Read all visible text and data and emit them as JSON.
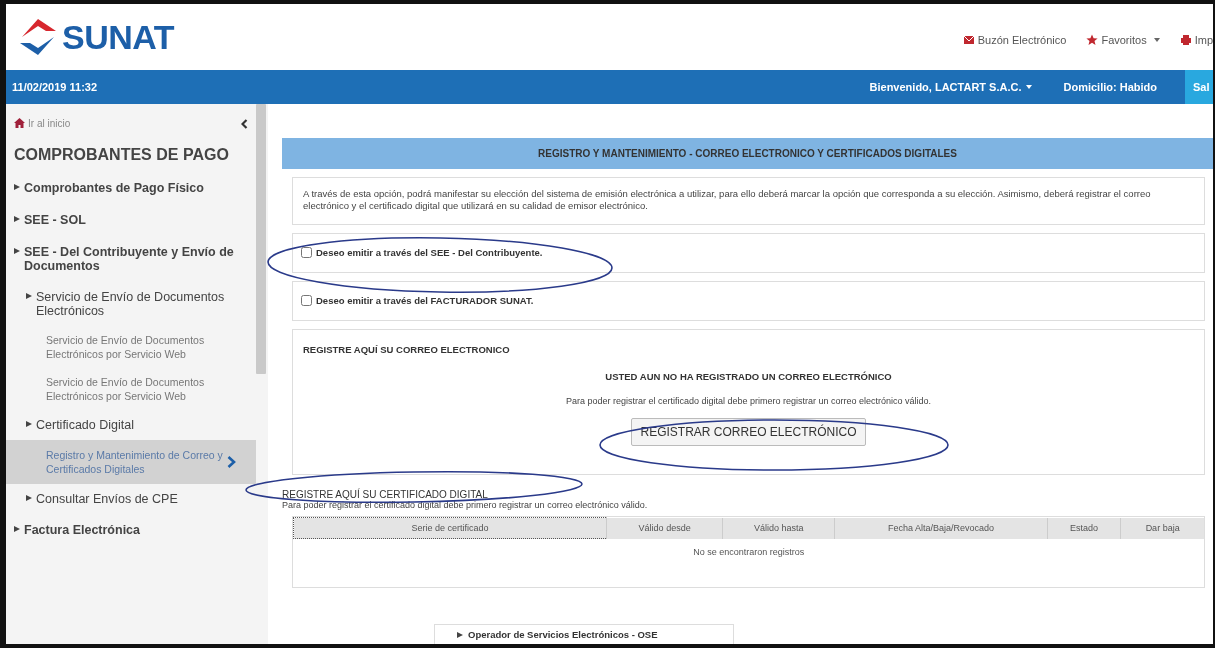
{
  "header": {
    "logo": "SUNAT",
    "links": [
      {
        "kind": "mail",
        "label": "Buzón Electrónico"
      },
      {
        "kind": "star",
        "label": "Favoritos",
        "dropdown": true
      },
      {
        "kind": "print",
        "label": "Imp"
      }
    ]
  },
  "top_bar": {
    "datetime": "11/02/2019 11:32",
    "welcome": "Bienvenido, LACTART S.A.C.",
    "domicile": "Domicilio: Habido",
    "button": "Sal"
  },
  "sidebar": {
    "home": "Ir al inicio",
    "heading": "COMPROBANTES DE PAGO",
    "items": [
      {
        "label": "Comprobantes de Pago Físico",
        "kind": "group",
        "selected": false
      },
      {
        "label": "SEE - SOL",
        "kind": "group",
        "selected": false
      },
      {
        "label": "SEE - Del Contribuyente y Envío de Documentos",
        "kind": "group",
        "selected": false,
        "children": [
          {
            "label": "Servicio de Envío de Documentos Electrónicos",
            "kind": "group",
            "selected": false,
            "children": [
              {
                "label": "Servicio de Envío de Documentos Electrónicos por Servicio Web",
                "kind": "link",
                "selected": false
              },
              {
                "label": "Servicio de Envío de Documentos Electrónicos por Servicio Web",
                "kind": "link",
                "selected": false
              }
            ]
          },
          {
            "label": "Certificado Digital",
            "kind": "group",
            "selected": false,
            "children": [
              {
                "label": "Registro y Mantenimiento de Correo y Certificados Digitales",
                "kind": "link",
                "selected": true
              }
            ]
          },
          {
            "label": "Consultar Envíos de CPE",
            "kind": "group",
            "selected": false
          }
        ]
      },
      {
        "label": "Factura Electrónica",
        "kind": "group",
        "selected": false
      }
    ]
  },
  "main": {
    "title": "REGISTRO Y MANTENIMIENTO - CORREO ELECTRONICO Y CERTIFICADOS DIGITALES",
    "intro": "A través de esta opción, podrá manifestar su elección del sistema de emisión electrónica a utilizar, para ello deberá marcar la opción que corresponda a su elección. Asimismo, deberá registrar el correo electrónico y el certificado digital que utilizará en su calidad de emisor electrónico.",
    "options": [
      {
        "label": "Deseo emitir a través del SEE - Del Contribuyente.",
        "checked": false
      },
      {
        "label": "Deseo emitir a través del FACTURADOR SUNAT.",
        "checked": false
      }
    ],
    "email": {
      "heading": "REGISTRE AQUÍ SU CORREO ELECTRONICO",
      "notice": "USTED AUN NO HA REGISTRADO UN CORREO ELECTRÓNICO",
      "hint": "Para poder registrar el certificado digital debe primero registrar un correo electrónico válido.",
      "button": "REGISTRAR CORREO ELECTRÓNICO"
    },
    "certificate": {
      "heading": "REGISTRE AQUÍ SU CERTIFICADO DIGITAL",
      "hint": "Para poder registrar el certificado digital debe primero registrar un correo electrónico válido.",
      "table": {
        "columns": [
          "Serie de certificado",
          "Válido desde",
          "Válido hasta",
          "Fecha Alta/Baja/Revocado",
          "Estado",
          "Dar baja"
        ],
        "empty": "No se encontraron registros"
      }
    }
  },
  "footer_popup": "Operador de Servicios Electrónicos - OSE"
}
